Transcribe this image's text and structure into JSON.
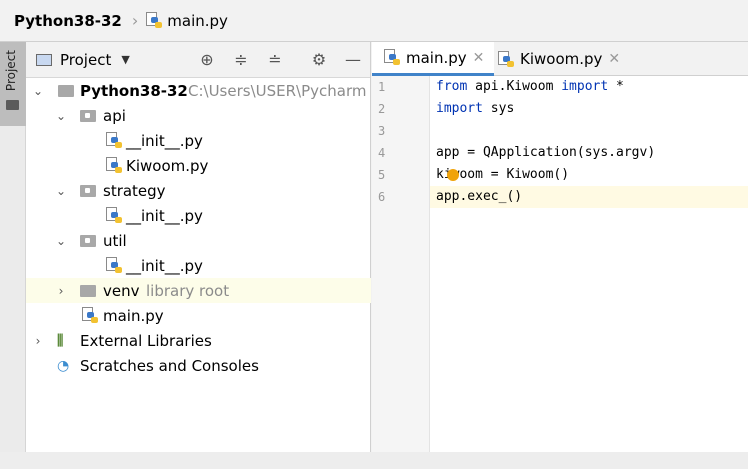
{
  "breadcrumb": {
    "project": "Python38-32",
    "file": "main.py"
  },
  "side_tool": {
    "label": "Project"
  },
  "project_panel": {
    "title": "Project"
  },
  "tree": {
    "root_name": "Python38-32",
    "root_path": "C:\\Users\\USER\\Pycharm",
    "api": "api",
    "api_init": "__init__.py",
    "api_kiwoom": "Kiwoom.py",
    "strategy": "strategy",
    "strategy_init": "__init__.py",
    "util": "util",
    "util_init": "__init__.py",
    "venv": "venv",
    "venv_note": "library root",
    "main": "main.py",
    "ext_libs": "External Libraries",
    "scratches": "Scratches and Consoles"
  },
  "editor": {
    "tabs": [
      {
        "label": "main.py",
        "active": true
      },
      {
        "label": "Kiwoom.py",
        "active": false
      }
    ],
    "line_numbers": [
      "1",
      "2",
      "3",
      "4",
      "5",
      "6"
    ],
    "lines": {
      "l1_kw": "from",
      "l1_mod": " api.Kiwoom ",
      "l1_kw2": "import",
      "l1_star": " *",
      "l2_kw": "import",
      "l2_mod": " sys",
      "l4": "app = QApplication(sys.argv)",
      "l5": "kiwoom = Kiwoom()",
      "l6": "app.exec_()"
    }
  },
  "colors": {
    "keyword": "#0033b3",
    "tab_accent": "#4083c9",
    "highlight_row": "#fdfde9"
  }
}
